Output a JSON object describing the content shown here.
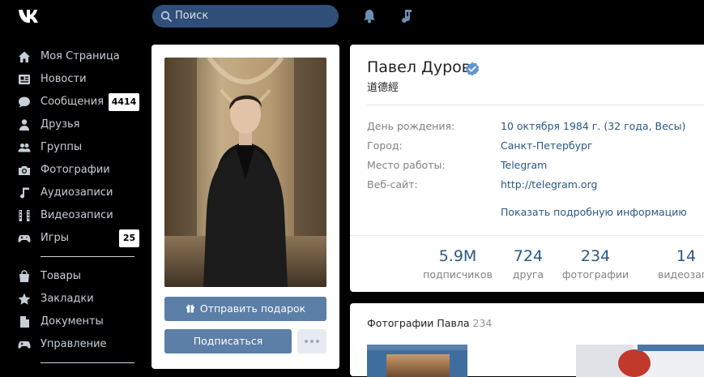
{
  "search": {
    "placeholder": "Поиск"
  },
  "sidebar": {
    "items": [
      {
        "label": "Моя Страница",
        "icon": "home-icon"
      },
      {
        "label": "Новости",
        "icon": "news-icon"
      },
      {
        "label": "Сообщения",
        "icon": "messages-icon",
        "badge": "4414"
      },
      {
        "label": "Друзья",
        "icon": "friends-icon"
      },
      {
        "label": "Группы",
        "icon": "groups-icon"
      },
      {
        "label": "Фотографии",
        "icon": "camera-icon"
      },
      {
        "label": "Аудиозаписи",
        "icon": "music-icon"
      },
      {
        "label": "Видеозаписи",
        "icon": "film-icon"
      },
      {
        "label": "Игры",
        "icon": "gamepad-icon",
        "badge": "25"
      }
    ],
    "secondary": [
      {
        "label": "Товары",
        "icon": "bag-icon"
      },
      {
        "label": "Закладки",
        "icon": "star-icon"
      },
      {
        "label": "Документы",
        "icon": "document-icon"
      },
      {
        "label": "Управление",
        "icon": "gamepad-icon"
      }
    ]
  },
  "profile": {
    "name": "Павел Дуров",
    "status": "道德經",
    "rows": [
      {
        "label": "День рождения:",
        "value": "10 октября 1984 г. (32 года, Весы)"
      },
      {
        "label": "Город:",
        "value": "Санкт-Петербург"
      },
      {
        "label": "Место работы:",
        "value": "Telegram"
      },
      {
        "label": "Веб-сайт:",
        "value": "http://telegram.org"
      }
    ],
    "more_info": "Показать подробную информацию",
    "stats": [
      {
        "value": "5.9M",
        "label": "подписчиков"
      },
      {
        "value": "724",
        "label": "друга"
      },
      {
        "value": "234",
        "label": "фотографии"
      },
      {
        "value": "14",
        "label": "видеозапи"
      }
    ]
  },
  "actions": {
    "gift_label": "Отправить подарок",
    "subscribe_label": "Подписаться"
  },
  "photos": {
    "title": "Фотографии Павла",
    "count": "234"
  },
  "colors": {
    "accent": "#5b7fa6",
    "link": "#2a5885",
    "background": "#000000",
    "search_bg": "#2f4e78"
  }
}
